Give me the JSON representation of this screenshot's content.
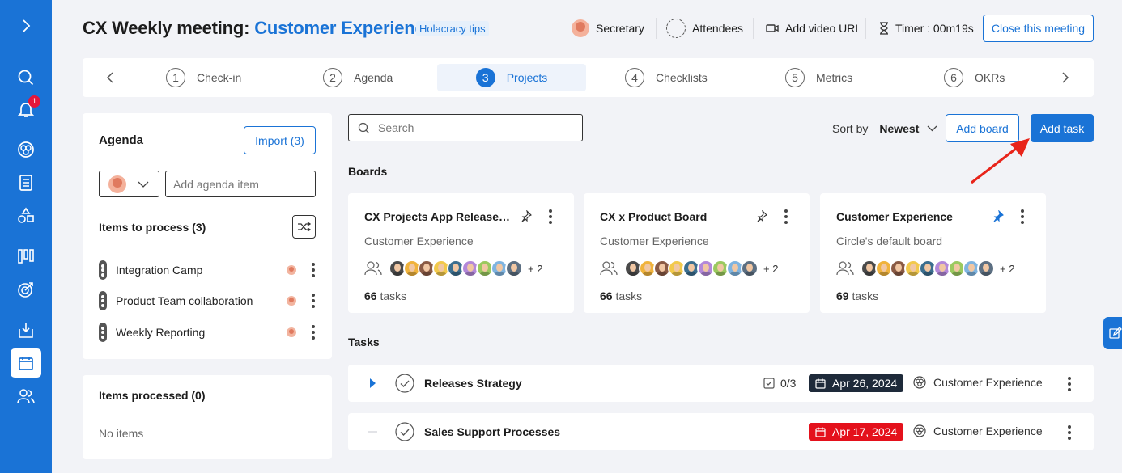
{
  "header": {
    "title_prefix": "CX Weekly meeting:",
    "title_circle": "Customer Experience",
    "tips_label": "Holacracy tips",
    "secretary_label": "Secretary",
    "attendees_label": "Attendees",
    "video_label": "Add video URL",
    "timer_label": "Timer : 00m19s",
    "close_label": "Close this meeting"
  },
  "sidebar": {
    "notification_count": "1",
    "icons": [
      "chevron-right-icon",
      "search-icon",
      "bell-icon",
      "circles-icon",
      "document-icon",
      "shapes-icon",
      "boards-icon",
      "target-icon",
      "download-icon",
      "calendar-icon",
      "people-icon"
    ]
  },
  "steps": [
    {
      "num": "1",
      "label": "Check-in"
    },
    {
      "num": "2",
      "label": "Agenda"
    },
    {
      "num": "3",
      "label": "Projects"
    },
    {
      "num": "4",
      "label": "Checklists"
    },
    {
      "num": "5",
      "label": "Metrics"
    },
    {
      "num": "6",
      "label": "OKRs"
    }
  ],
  "agenda": {
    "title": "Agenda",
    "import_label": "Import (3)",
    "input_placeholder": "Add agenda item",
    "to_process_label": "Items to process (3)",
    "items": [
      "Integration Camp",
      "Product Team collaboration",
      "Weekly Reporting"
    ],
    "processed_label": "Items processed (0)",
    "empty_label": "No items"
  },
  "toolbar": {
    "search_placeholder": "Search",
    "sort_label": "Sort by",
    "sort_value": "Newest",
    "add_board_label": "Add board",
    "add_task_label": "Add task"
  },
  "boards": {
    "section_label": "Boards",
    "cards": [
      {
        "title": "CX Projects App Release Board",
        "subtitle": "Customer Experience",
        "extra": "+ 2",
        "task_count": "66",
        "task_label": "tasks",
        "pinned": false
      },
      {
        "title": "CX x Product Board",
        "subtitle": "Customer Experience",
        "extra": "+ 2",
        "task_count": "66",
        "task_label": "tasks",
        "pinned": false
      },
      {
        "title": "Customer Experience",
        "subtitle": "Circle's default board",
        "extra": "+ 2",
        "task_count": "69",
        "task_label": "tasks",
        "pinned": true
      }
    ]
  },
  "tasks": {
    "section_label": "Tasks",
    "items": [
      {
        "name": "Releases Strategy",
        "checklist": "0/3",
        "date": "Apr 26, 2024",
        "circle": "Customer Experience",
        "date_color": "#1e2a3a"
      },
      {
        "name": "Sales Support Processes",
        "checklist": "",
        "date": "Apr 17, 2024",
        "circle": "Customer Experience",
        "date_color": "#e4111c"
      }
    ]
  },
  "colors": {
    "accent": "#1a73d6",
    "annotation_arrow": "#e8241a",
    "avatars": [
      "#4a4a4a",
      "#f0b33c",
      "#8a5a44",
      "#f2c94c",
      "#3b6e8f",
      "#b388d9",
      "#9bc95f",
      "#7fb4e0",
      "#5c6f82"
    ]
  }
}
